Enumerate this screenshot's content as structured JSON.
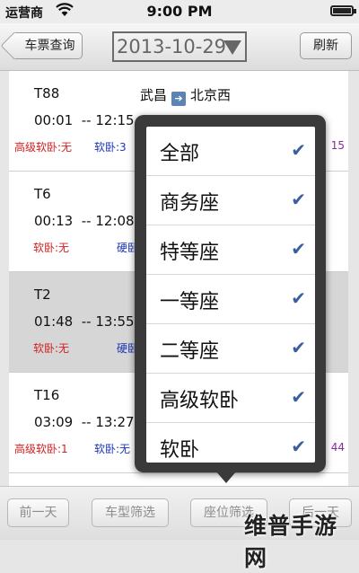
{
  "status_bar": {
    "carrier": "运营商",
    "time": "9:00 PM"
  },
  "nav": {
    "back_label": "车票查询",
    "date_value": "2013-10-29",
    "refresh_label": "刷新"
  },
  "trains": [
    {
      "code": "T88",
      "from": "武昌",
      "to": "北京西",
      "times": "00:01  -- 12:15",
      "seat_a": "高级软卧:无",
      "seat_b": "软卧:3",
      "right": "15"
    },
    {
      "code": "T6",
      "from": "",
      "to": "",
      "times": "00:13  -- 12:08",
      "seat_a": "软卧:无",
      "seat_b": "硬卧",
      "right": ""
    },
    {
      "code": "T2",
      "from": "",
      "to": "",
      "times": "01:48  -- 13:55",
      "seat_a": "软卧:无",
      "seat_b": "硬卧",
      "right": ""
    },
    {
      "code": "T16",
      "from": "",
      "to": "",
      "times": "03:09  -- 13:27",
      "seat_a": "高级软卧:1",
      "seat_b": "软卧:无",
      "right": "44"
    }
  ],
  "filter_popover": {
    "options": [
      {
        "label": "全部",
        "checked": "✔"
      },
      {
        "label": "商务座",
        "checked": "✔"
      },
      {
        "label": "特等座",
        "checked": "✔"
      },
      {
        "label": "一等座",
        "checked": "✔"
      },
      {
        "label": "二等座",
        "checked": "✔"
      },
      {
        "label": "高级软卧",
        "checked": "✔"
      },
      {
        "label": "软卧",
        "checked": "✔"
      }
    ]
  },
  "toolbar": {
    "prev_day": "前一天",
    "train_type_filter": "车型筛选",
    "seat_filter": "座位筛选",
    "next_day": "后一天"
  },
  "watermark": "维普手游网"
}
